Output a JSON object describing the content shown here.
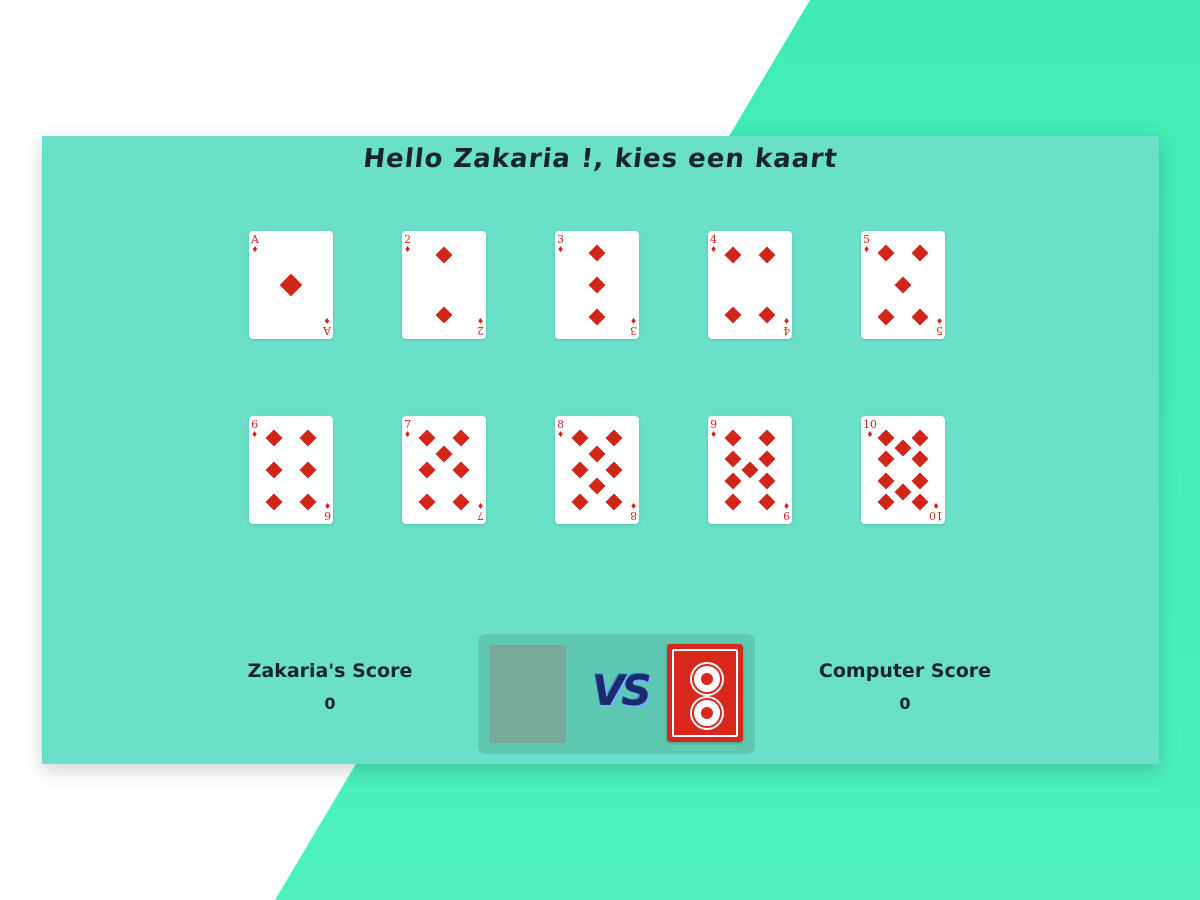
{
  "header": {
    "title": "Hello Zakaria !, kies een kaart"
  },
  "cards": [
    {
      "rank": "A",
      "suit": "♦"
    },
    {
      "rank": "2",
      "suit": "♦"
    },
    {
      "rank": "3",
      "suit": "♦"
    },
    {
      "rank": "4",
      "suit": "♦"
    },
    {
      "rank": "5",
      "suit": "♦"
    },
    {
      "rank": "6",
      "suit": "♦"
    },
    {
      "rank": "7",
      "suit": "♦"
    },
    {
      "rank": "8",
      "suit": "♦"
    },
    {
      "rank": "9",
      "suit": "♦"
    },
    {
      "rank": "10",
      "suit": "♦"
    }
  ],
  "player": {
    "label": "Zakaria's Score",
    "score": "0"
  },
  "computer": {
    "label": "Computer Score",
    "score": "0"
  },
  "battle": {
    "vs_label": "VS"
  },
  "colors": {
    "accent": "#6be0c8",
    "card_red": "#d0261a",
    "background_shape": "#40ebb6"
  }
}
